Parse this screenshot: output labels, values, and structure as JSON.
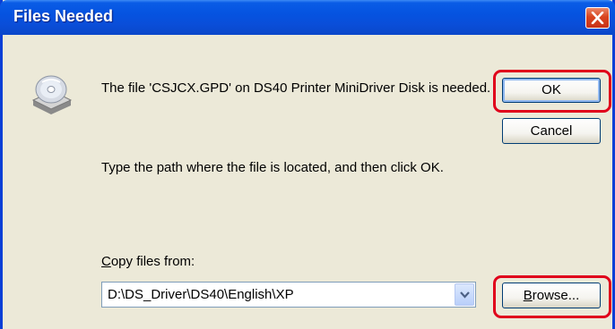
{
  "dialog": {
    "title": "Files Needed",
    "message": "The file 'CSJCX.GPD' on DS40 Printer MiniDriver Disk is needed.",
    "instruction": "Type the path where the file is located, and then click OK.",
    "copy_from_label_prefix": "C",
    "copy_from_label_rest": "opy files from:",
    "copy_from_value": "D:\\DS_Driver\\DS40\\English\\XP",
    "ok_label": "OK",
    "cancel_label": "Cancel",
    "browse_label_prefix": "B",
    "browse_label_rest": "rowse...",
    "icons": {
      "close": "close-icon",
      "disk": "cd-drive-icon",
      "dropdown": "chevron-down-icon"
    },
    "colors": {
      "titlebar": "#0553e0",
      "body": "#ece9d8",
      "close": "#d9441e",
      "highlight": "#e0001b"
    }
  }
}
